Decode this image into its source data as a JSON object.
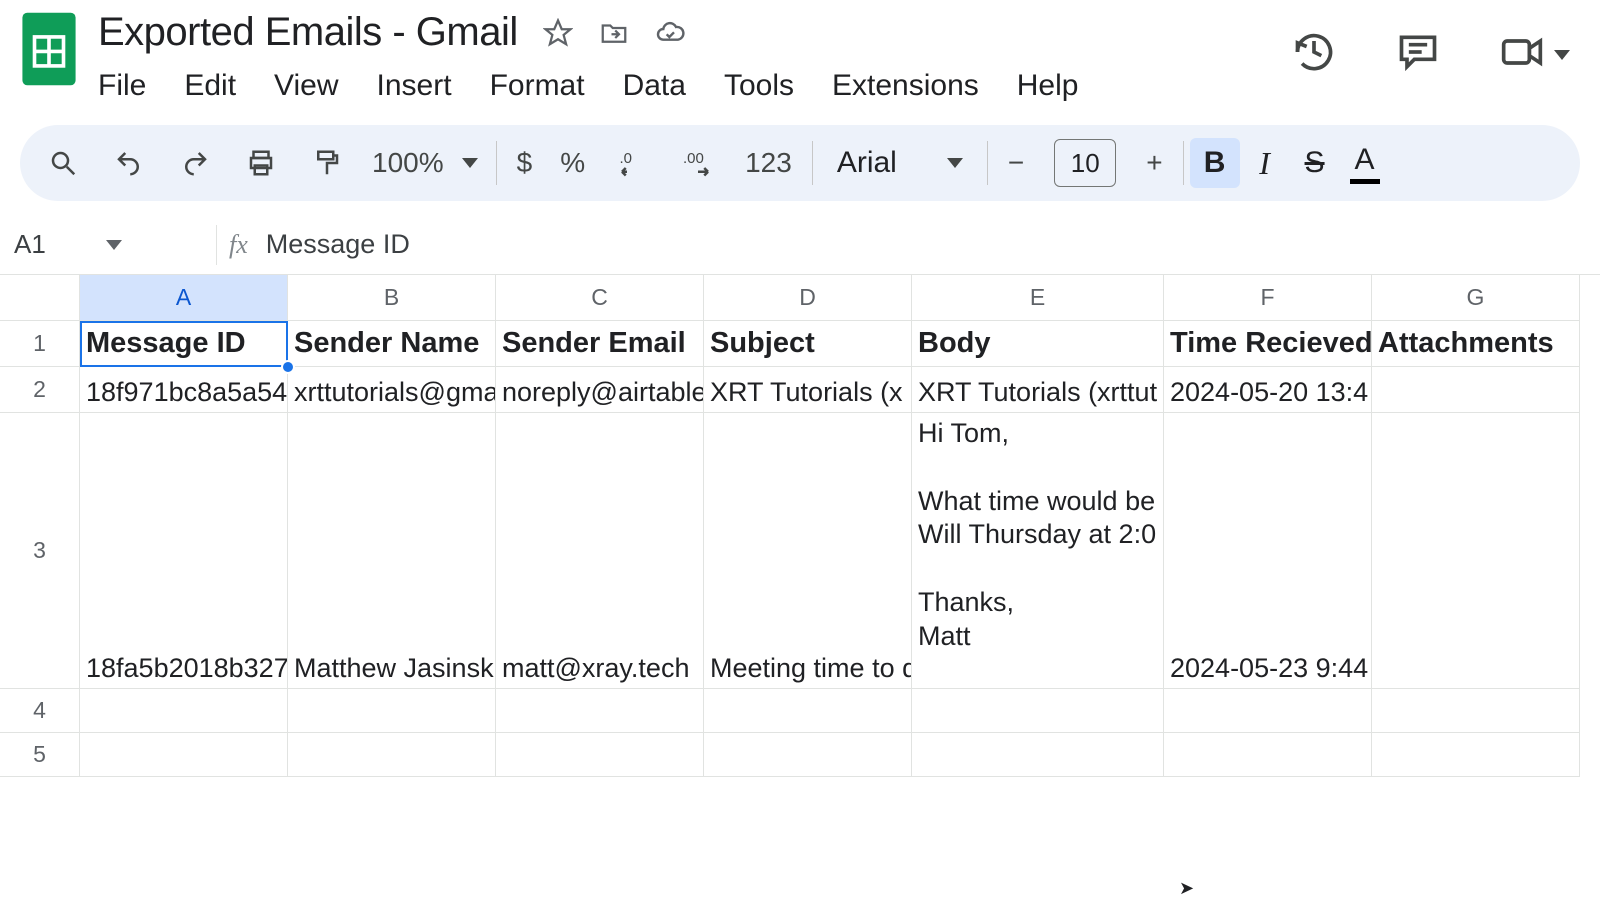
{
  "doc": {
    "title": "Exported Emails - Gmail"
  },
  "menu": {
    "file": "File",
    "edit": "Edit",
    "view": "View",
    "insert": "Insert",
    "format": "Format",
    "data": "Data",
    "tools": "Tools",
    "extensions": "Extensions",
    "help": "Help"
  },
  "toolbar": {
    "zoom": "100%",
    "dollar": "$",
    "percent": "%",
    "dec_dec": ".0",
    "inc_dec": ".00",
    "numfmt": "123",
    "font": "Arial",
    "minus": "−",
    "size": "10",
    "plus": "+",
    "bold": "B",
    "italic": "I",
    "strike": "S",
    "textcolor": "A"
  },
  "namebox": "A1",
  "fx": "fx",
  "formula": "Message ID",
  "columns": [
    "A",
    "B",
    "C",
    "D",
    "E",
    "F",
    "G"
  ],
  "rows": [
    "1",
    "2",
    "3",
    "4",
    "5"
  ],
  "headers": {
    "A": "Message ID",
    "B": "Sender Name",
    "C": "Sender Email",
    "D": "Subject",
    "E": "Body",
    "F": "Time Recieved",
    "G": "Attachments"
  },
  "data": {
    "r2": {
      "A": "18f971bc8a5a54",
      "B": "xrttutorials@gma",
      "C": "noreply@airtable",
      "D": "XRT Tutorials (x",
      "E": "XRT Tutorials (xrttut",
      "F": "2024-05-20 13:4",
      "G": ""
    },
    "r3": {
      "A": "18fa5b2018b327",
      "B": "Matthew Jasinsk",
      "C": "matt@xray.tech",
      "D": "Meeting time to d",
      "E": "Hi Tom,\n\nWhat time would be\nWill Thursday at 2:0\n\nThanks,\nMatt",
      "F": "2024-05-23 9:44",
      "G": ""
    }
  }
}
